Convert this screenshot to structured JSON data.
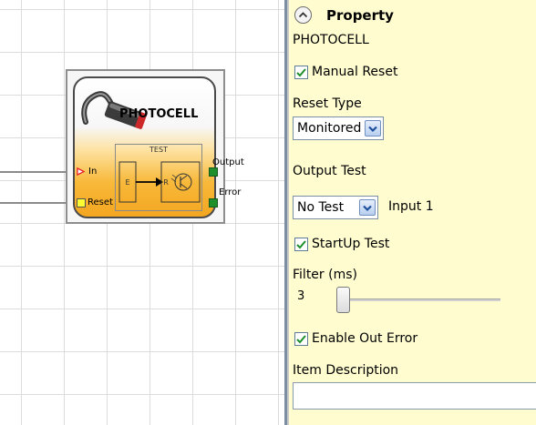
{
  "canvas": {
    "block": {
      "title": "PHOTOCELL",
      "test_label": "TEST",
      "emitter_label": "E",
      "receiver_label": "R",
      "ports": {
        "in": "In",
        "reset": "Reset",
        "output": "Output",
        "error": "Error"
      }
    }
  },
  "panel": {
    "title": "Property",
    "block_name": "PHOTOCELL",
    "manual_reset": {
      "label": "Manual Reset",
      "checked": true
    },
    "reset_type": {
      "label": "Reset Type",
      "value": "Monitored"
    },
    "output_test": {
      "label": "Output Test",
      "value": "No Test",
      "input_label": "Input 1"
    },
    "startup_test": {
      "label": "StartUp Test",
      "checked": true
    },
    "filter": {
      "label": "Filter (ms)",
      "value": "3"
    },
    "enable_out_error": {
      "label": "Enable Out Error",
      "checked": true
    },
    "item_description": {
      "label": "Item Description",
      "value": ""
    }
  },
  "colors": {
    "panel_bg": "#fffdd0",
    "block_orange": "#f3a620",
    "port_green": "#1e8f2a",
    "port_yellow": "#ffff33",
    "in_port_red": "#e8212a",
    "checkbox_check": "#1e8f2a"
  },
  "icons": [
    "collapse-up-icon",
    "photocell-sensor-icon",
    "checkmark-icon",
    "chevron-down-icon",
    "phototransistor-icon"
  ]
}
